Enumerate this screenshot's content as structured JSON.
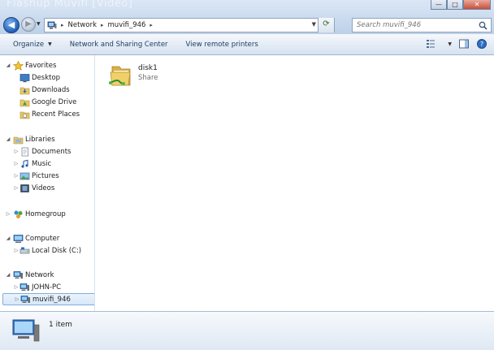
{
  "window": {
    "title_ghost": "Flashup Muvifi [Video]",
    "minimize_label": "—",
    "maximize_label": "□",
    "close_label": "✕"
  },
  "nav": {
    "back_glyph": "◀",
    "forward_glyph": "▶",
    "recent_glyph": "▼",
    "back_icon": "back-arrow-icon",
    "forward_icon": "forward-arrow-icon"
  },
  "address": {
    "root_icon": "network-icon",
    "segments": [
      "Network",
      "muvifi_946"
    ],
    "separator": "▸",
    "dropdown_glyph": "▼",
    "refresh_glyph": "⟳"
  },
  "search": {
    "placeholder": "Search muvifi_946",
    "icon": "search-icon"
  },
  "toolbar": {
    "organize_label": "Organize",
    "caret": "▼",
    "network_sharing_label": "Network and Sharing Center",
    "view_remote_printers_label": "View remote printers",
    "views_icon": "views-icon",
    "preview_pane_icon": "preview-pane-icon",
    "help_icon": "help-icon"
  },
  "sidebar": {
    "favorites": {
      "label": "Favorites",
      "icon": "star-icon",
      "items": [
        {
          "label": "Desktop",
          "icon": "desktop-icon"
        },
        {
          "label": "Downloads",
          "icon": "downloads-icon"
        },
        {
          "label": "Google Drive",
          "icon": "google-drive-icon"
        },
        {
          "label": "Recent Places",
          "icon": "recent-places-icon"
        }
      ]
    },
    "libraries": {
      "label": "Libraries",
      "icon": "libraries-icon",
      "items": [
        {
          "label": "Documents",
          "icon": "documents-icon"
        },
        {
          "label": "Music",
          "icon": "music-icon"
        },
        {
          "label": "Pictures",
          "icon": "pictures-icon"
        },
        {
          "label": "Videos",
          "icon": "videos-icon"
        }
      ]
    },
    "homegroup": {
      "label": "Homegroup",
      "icon": "homegroup-icon"
    },
    "computer": {
      "label": "Computer",
      "icon": "computer-icon",
      "items": [
        {
          "label": "Local Disk (C:)",
          "icon": "local-disk-icon"
        }
      ]
    },
    "network": {
      "label": "Network",
      "icon": "network-icon",
      "items": [
        {
          "label": "JOHN-PC",
          "icon": "computer-icon"
        },
        {
          "label": "muvifi_946",
          "icon": "computer-icon",
          "selected": true
        }
      ]
    },
    "expand_glyph": "▷",
    "collapse_glyph": "◢"
  },
  "content": {
    "items": [
      {
        "name": "disk1",
        "subtitle": "Share",
        "icon": "shared-folder-icon"
      }
    ]
  },
  "details": {
    "icon": "computer-icon",
    "count_text": "1 item"
  }
}
